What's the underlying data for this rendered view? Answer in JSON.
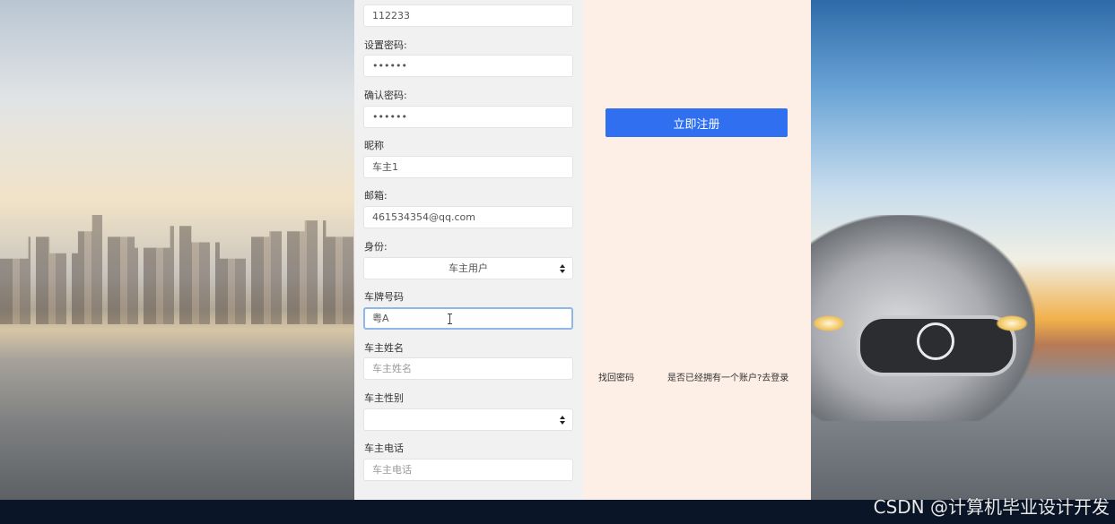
{
  "form": {
    "account_value": "112233",
    "password_label": "设置密码:",
    "password_value": "••••••",
    "confirm_label": "确认密码:",
    "confirm_value": "••••••",
    "nickname_label": "昵称",
    "nickname_value": "车主1",
    "email_label": "邮箱:",
    "email_value": "461534354@qq.com",
    "identity_label": "身份:",
    "identity_value": "车主用户",
    "plate_label": "车牌号码",
    "plate_value": "粤A",
    "owner_name_label": "车主姓名",
    "owner_name_placeholder": "车主姓名",
    "owner_gender_label": "车主性别",
    "owner_gender_value": "",
    "owner_phone_label": "车主电话",
    "owner_phone_placeholder": "车主电话"
  },
  "actions": {
    "register_label": "立即注册",
    "forgot_password": "找回密码",
    "have_account": "是否已经拥有一个账户?去登录"
  },
  "watermark": "CSDN @计算机毕业设计开发",
  "colors": {
    "primary": "#2f6ff0",
    "form_bg": "#f1f1f1",
    "side_bg": "#fdefe6",
    "footer": "#0a1628",
    "focus_border": "#8fb7e8"
  }
}
